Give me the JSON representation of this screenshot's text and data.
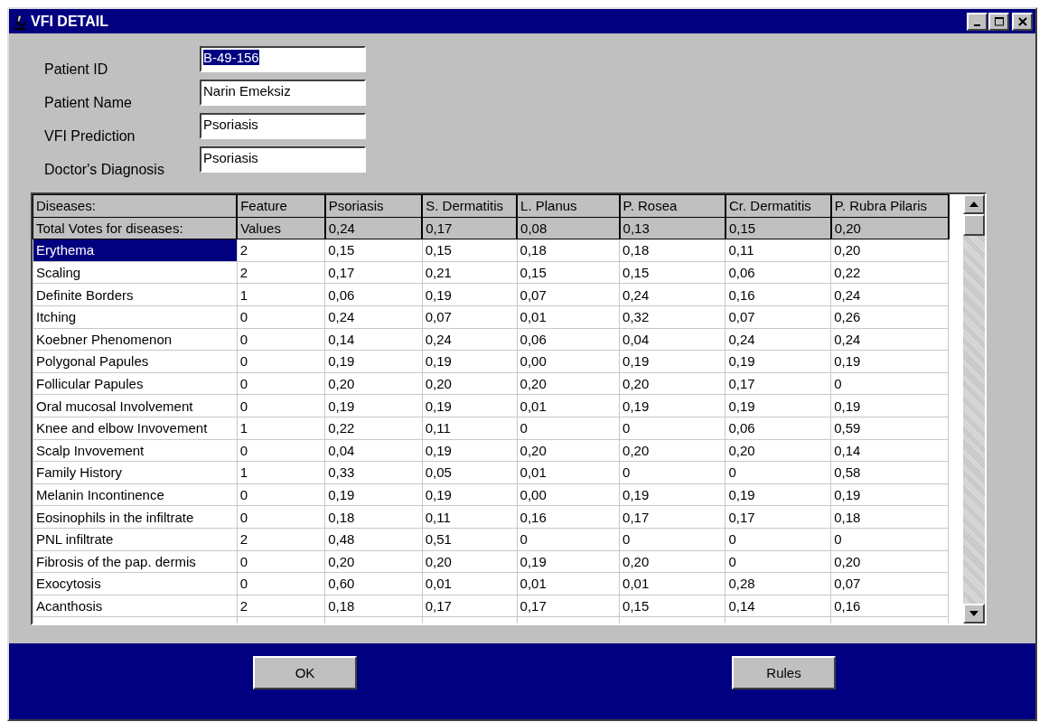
{
  "window": {
    "title": "VFI DETAIL"
  },
  "fields": [
    {
      "label": "Patient ID",
      "value": "B-49-156",
      "selected": true
    },
    {
      "label": "Patient Name",
      "value": "Narin  Emeksiz",
      "selected": false
    },
    {
      "label": "VFI  Prediction",
      "value": "Psoriasis",
      "selected": false
    },
    {
      "label": "Doctor's  Diagnosis",
      "value": "Psoriasis",
      "selected": false
    }
  ],
  "table": {
    "columns": [
      "Diseases:",
      "Feature",
      "Psoriasis",
      "S. Dermatitis",
      "L. Planus",
      "P. Rosea",
      "Cr. Dermatitis",
      "P. Rubra Pilaris"
    ],
    "totals": [
      "Total Votes for diseases:",
      "Values",
      "0,24",
      "0,17",
      "0,08",
      "0,13",
      "0,15",
      "0,20"
    ],
    "rows": [
      {
        "cells": [
          "Erythema",
          "2",
          "0,15",
          "0,15",
          "0,18",
          "0,18",
          "0,11",
          "0,20"
        ],
        "selected": true
      },
      {
        "cells": [
          "Scaling",
          "2",
          "0,17",
          "0,21",
          "0,15",
          "0,15",
          "0,06",
          "0,22"
        ],
        "selected": false
      },
      {
        "cells": [
          "Definite Borders",
          "1",
          "0,06",
          "0,19",
          "0,07",
          "0,24",
          "0,16",
          "0,24"
        ],
        "selected": false
      },
      {
        "cells": [
          "Itching",
          "0",
          "0,24",
          "0,07",
          "0,01",
          "0,32",
          "0,07",
          "0,26"
        ],
        "selected": false
      },
      {
        "cells": [
          "Koebner Phenomenon",
          "0",
          "0,14",
          "0,24",
          "0,06",
          "0,04",
          "0,24",
          "0,24"
        ],
        "selected": false
      },
      {
        "cells": [
          "Polygonal Papules",
          "0",
          "0,19",
          "0,19",
          "0,00",
          "0,19",
          "0,19",
          "0,19"
        ],
        "selected": false
      },
      {
        "cells": [
          "Follicular Papules",
          "0",
          "0,20",
          "0,20",
          "0,20",
          "0,20",
          "0,17",
          "0"
        ],
        "selected": false
      },
      {
        "cells": [
          "Oral mucosal Involvement",
          "0",
          "0,19",
          "0,19",
          "0,01",
          "0,19",
          "0,19",
          "0,19"
        ],
        "selected": false
      },
      {
        "cells": [
          "Knee and elbow Invovement",
          "1",
          "0,22",
          "0,11",
          "0",
          "0",
          "0,06",
          "0,59"
        ],
        "selected": false
      },
      {
        "cells": [
          "Scalp Invovement",
          "0",
          "0,04",
          "0,19",
          "0,20",
          "0,20",
          "0,20",
          "0,14"
        ],
        "selected": false
      },
      {
        "cells": [
          "Family History",
          "1",
          "0,33",
          "0,05",
          "0,01",
          "0",
          "0",
          "0,58"
        ],
        "selected": false
      },
      {
        "cells": [
          "Melanin Incontinence",
          "0",
          "0,19",
          "0,19",
          "0,00",
          "0,19",
          "0,19",
          "0,19"
        ],
        "selected": false
      },
      {
        "cells": [
          "Eosinophils in the infiltrate",
          "0",
          "0,18",
          "0,11",
          "0,16",
          "0,17",
          "0,17",
          "0,18"
        ],
        "selected": false
      },
      {
        "cells": [
          "PNL infiltrate",
          "2",
          "0,48",
          "0,51",
          "0",
          "0",
          "0",
          "0"
        ],
        "selected": false
      },
      {
        "cells": [
          "Fibrosis of the pap. dermis",
          "0",
          "0,20",
          "0,20",
          "0,19",
          "0,20",
          "0",
          "0,20"
        ],
        "selected": false
      },
      {
        "cells": [
          "Exocytosis",
          "0",
          "0,60",
          "0,01",
          "0,01",
          "0,01",
          "0,28",
          "0,07"
        ],
        "selected": false
      },
      {
        "cells": [
          "Acanthosis",
          "2",
          "0,18",
          "0,17",
          "0,17",
          "0,15",
          "0,14",
          "0,16"
        ],
        "selected": false
      }
    ]
  },
  "buttons": [
    "OK",
    "Rules"
  ]
}
